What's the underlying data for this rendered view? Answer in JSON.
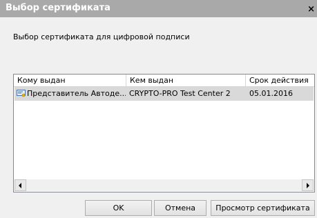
{
  "dialog": {
    "title": "Выбор сертификата",
    "close_glyph": "×",
    "instruction": "Выбор сертификата для цифровой подписи"
  },
  "table": {
    "columns": [
      "Кому выдан",
      "Кем выдан",
      "Срок действия"
    ],
    "rows": [
      {
        "icon": "certificate-icon",
        "issued_to": "Представитель Автоде...",
        "issued_by": "CRYPTO-PRO Test Center 2",
        "valid_until": "05.01.2016",
        "selected": true
      }
    ]
  },
  "buttons": {
    "ok": "OK",
    "cancel": "Отмена",
    "view_certificate": "Просмотр сертификата"
  },
  "colors": {
    "titlebar": "#a9a9a9",
    "selected_row": "#d9d9d9",
    "dialog_bg": "#f0f0f0"
  }
}
